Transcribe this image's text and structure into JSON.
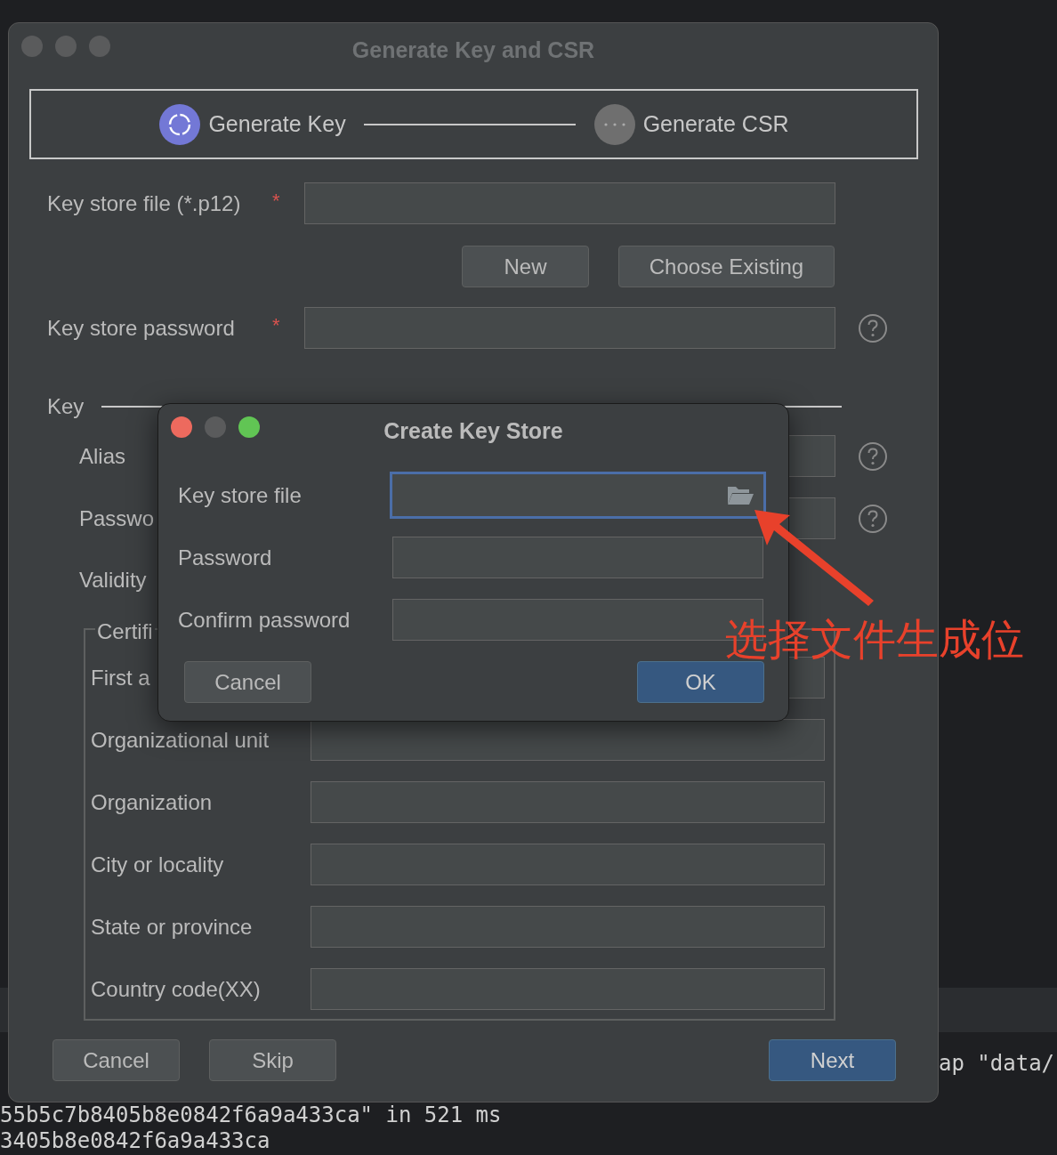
{
  "terminal": {
    "lines": [
      {
        "text": "ap \"data/"
      },
      {
        "text": "55b5c7b8405b8e0842f6a9a433ca\" in 521 ms"
      },
      {
        "text": "3405b8e0842f6a9a433ca"
      }
    ]
  },
  "window": {
    "title": "Generate Key and CSR",
    "active": false,
    "steps": [
      {
        "label": "Generate Key",
        "active": true
      },
      {
        "label": "Generate CSR",
        "active": false
      }
    ],
    "keystore_rows": [
      {
        "label": "Key store file (*.p12)",
        "marker": "*",
        "help": false
      },
      {
        "label": "Key store password",
        "marker": "*",
        "help": true
      }
    ],
    "keystore_buttons": [
      "New",
      "Choose Existing"
    ],
    "key_section": {
      "title": "Key",
      "rows": [
        {
          "label": "Alias",
          "help": true
        },
        {
          "label": "Passwo",
          "help": true
        },
        {
          "label": "Validity",
          "help": false
        }
      ]
    },
    "certificate": {
      "title": "Certifi",
      "rows": [
        "First a",
        "Organizational unit",
        "Organization",
        "City or locality",
        "State or province",
        "Country code(XX)"
      ]
    },
    "buttons": [
      {
        "label": "Cancel",
        "primary": false
      },
      {
        "label": "Skip",
        "primary": false
      },
      {
        "label": "Next",
        "primary": true
      }
    ]
  },
  "dialog": {
    "title": "Create Key Store",
    "active": true,
    "fields": [
      {
        "label": "Key store file",
        "kind": "file",
        "focused": true
      },
      {
        "label": "Password",
        "kind": "text",
        "focused": false
      },
      {
        "label": "Confirm password",
        "kind": "text",
        "focused": false
      }
    ],
    "buttons": [
      {
        "label": "Cancel",
        "primary": false
      },
      {
        "label": "OK",
        "primary": true
      }
    ]
  },
  "annotation": {
    "text": "选择文件生成位"
  }
}
